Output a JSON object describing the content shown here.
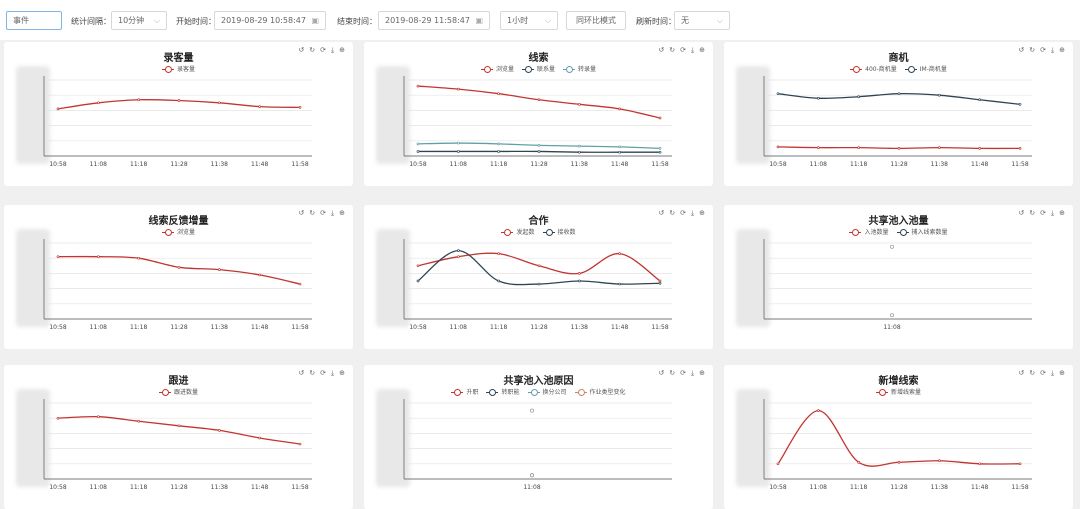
{
  "toolbar": {
    "mode": "事件",
    "interval_label": "统计间隔：",
    "interval_value": "10分钟",
    "start_label": "开始时间：",
    "start_value": "2019-08-29 10:58:47",
    "end_label": "结束时间：",
    "end_value": "2019-08-29 11:58:47",
    "range_value": "1小时",
    "compare_button": "同环比模式",
    "refresh_label": "刷新时间：",
    "refresh_value": "无"
  },
  "panels": [
    {
      "title": "录客量",
      "legend": [
        "录客量"
      ]
    },
    {
      "title": "线索",
      "legend": [
        "浏览量",
        "联系量",
        "转录量"
      ]
    },
    {
      "title": "商机",
      "legend": [
        "400-商机量",
        "IM-商机量"
      ]
    },
    {
      "title": "线索反馈增量",
      "legend": [
        "浏览量"
      ]
    },
    {
      "title": "合作",
      "legend": [
        "发起数",
        "接收数"
      ]
    },
    {
      "title": "共享池入池量",
      "legend": [
        "入池数量",
        "捕入线索数量"
      ]
    },
    {
      "title": "跟进",
      "legend": [
        "跟进数量"
      ]
    },
    {
      "title": "共享池入池原因",
      "legend": [
        "升职",
        "转职能",
        "换分公司",
        "作业类型变化"
      ]
    },
    {
      "title": "新增线索",
      "legend": [
        "新增线索量"
      ]
    }
  ],
  "colors": {
    "red": "#c23531",
    "dark": "#2f4554",
    "teal": "#61a0a8",
    "orange": "#d48265"
  },
  "chart_data": [
    {
      "type": "line",
      "title": "录客量",
      "x": [
        "10:58",
        "11:08",
        "11:18",
        "11:28",
        "11:38",
        "11:48",
        "11:58"
      ],
      "series": [
        {
          "name": "录客量",
          "values": [
            62,
            70,
            74,
            73,
            70,
            65,
            64
          ]
        }
      ],
      "ylim": [
        0,
        100
      ]
    },
    {
      "type": "line",
      "title": "线索",
      "x": [
        "10:58",
        "11:08",
        "11:18",
        "11:28",
        "11:38",
        "11:48",
        "11:58"
      ],
      "series": [
        {
          "name": "浏览量",
          "values": [
            92,
            88,
            82,
            74,
            68,
            62,
            50
          ]
        },
        {
          "name": "联系量",
          "values": [
            6,
            6,
            6,
            6,
            5,
            5,
            5
          ]
        },
        {
          "name": "转录量",
          "values": [
            16,
            17,
            16,
            14,
            13,
            12,
            10
          ]
        }
      ],
      "ylim": [
        0,
        100
      ]
    },
    {
      "type": "line",
      "title": "商机",
      "x": [
        "10:58",
        "11:08",
        "11:18",
        "11:28",
        "11:38",
        "11:48",
        "11:58"
      ],
      "series": [
        {
          "name": "400-商机量",
          "values": [
            12,
            11,
            11,
            10,
            11,
            10,
            10
          ]
        },
        {
          "name": "IM-商机量",
          "values": [
            82,
            76,
            78,
            82,
            80,
            74,
            68
          ]
        }
      ],
      "ylim": [
        0,
        100
      ]
    },
    {
      "type": "line",
      "title": "线索反馈增量",
      "x": [
        "10:58",
        "11:08",
        "11:18",
        "11:28",
        "11:38",
        "11:48",
        "11:58"
      ],
      "series": [
        {
          "name": "浏览量",
          "values": [
            82,
            82,
            80,
            68,
            65,
            58,
            46
          ]
        }
      ],
      "ylim": [
        0,
        100
      ]
    },
    {
      "type": "line",
      "title": "合作",
      "x": [
        "10:58",
        "11:08",
        "11:18",
        "11:28",
        "11:38",
        "11:48",
        "11:58"
      ],
      "series": [
        {
          "name": "发起数",
          "values": [
            70,
            82,
            86,
            70,
            60,
            86,
            50
          ]
        },
        {
          "name": "接收数",
          "values": [
            50,
            90,
            50,
            46,
            50,
            46,
            47
          ]
        }
      ],
      "ylim": [
        0,
        100
      ]
    },
    {
      "type": "scatter",
      "title": "共享池入池量",
      "x": [
        "11:08"
      ],
      "series": [
        {
          "name": "入池数量",
          "values": [
            95
          ]
        },
        {
          "name": "捕入线索数量",
          "values": [
            5
          ]
        }
      ],
      "ylim": [
        0,
        100
      ]
    },
    {
      "type": "line",
      "title": "跟进",
      "x": [
        "10:58",
        "11:08",
        "11:18",
        "11:28",
        "11:38",
        "11:48",
        "11:58"
      ],
      "series": [
        {
          "name": "跟进数量",
          "values": [
            80,
            82,
            76,
            70,
            64,
            54,
            46
          ]
        }
      ],
      "ylim": [
        0,
        100
      ]
    },
    {
      "type": "scatter",
      "title": "共享池入池原因",
      "x": [
        "11:08"
      ],
      "series": [
        {
          "name": "升职",
          "values": [
            90
          ]
        },
        {
          "name": "转职能",
          "values": [
            5
          ]
        },
        {
          "name": "换分公司",
          "values": [
            5
          ]
        },
        {
          "name": "作业类型变化",
          "values": [
            5
          ]
        }
      ],
      "ylim": [
        0,
        100
      ]
    },
    {
      "type": "line",
      "title": "新增线索",
      "x": [
        "10:58",
        "11:08",
        "11:18",
        "11:28",
        "11:38",
        "11:48",
        "11:58"
      ],
      "series": [
        {
          "name": "新增线索量",
          "values": [
            20,
            90,
            22,
            22,
            24,
            20,
            20
          ]
        }
      ],
      "ylim": [
        0,
        100
      ]
    }
  ]
}
